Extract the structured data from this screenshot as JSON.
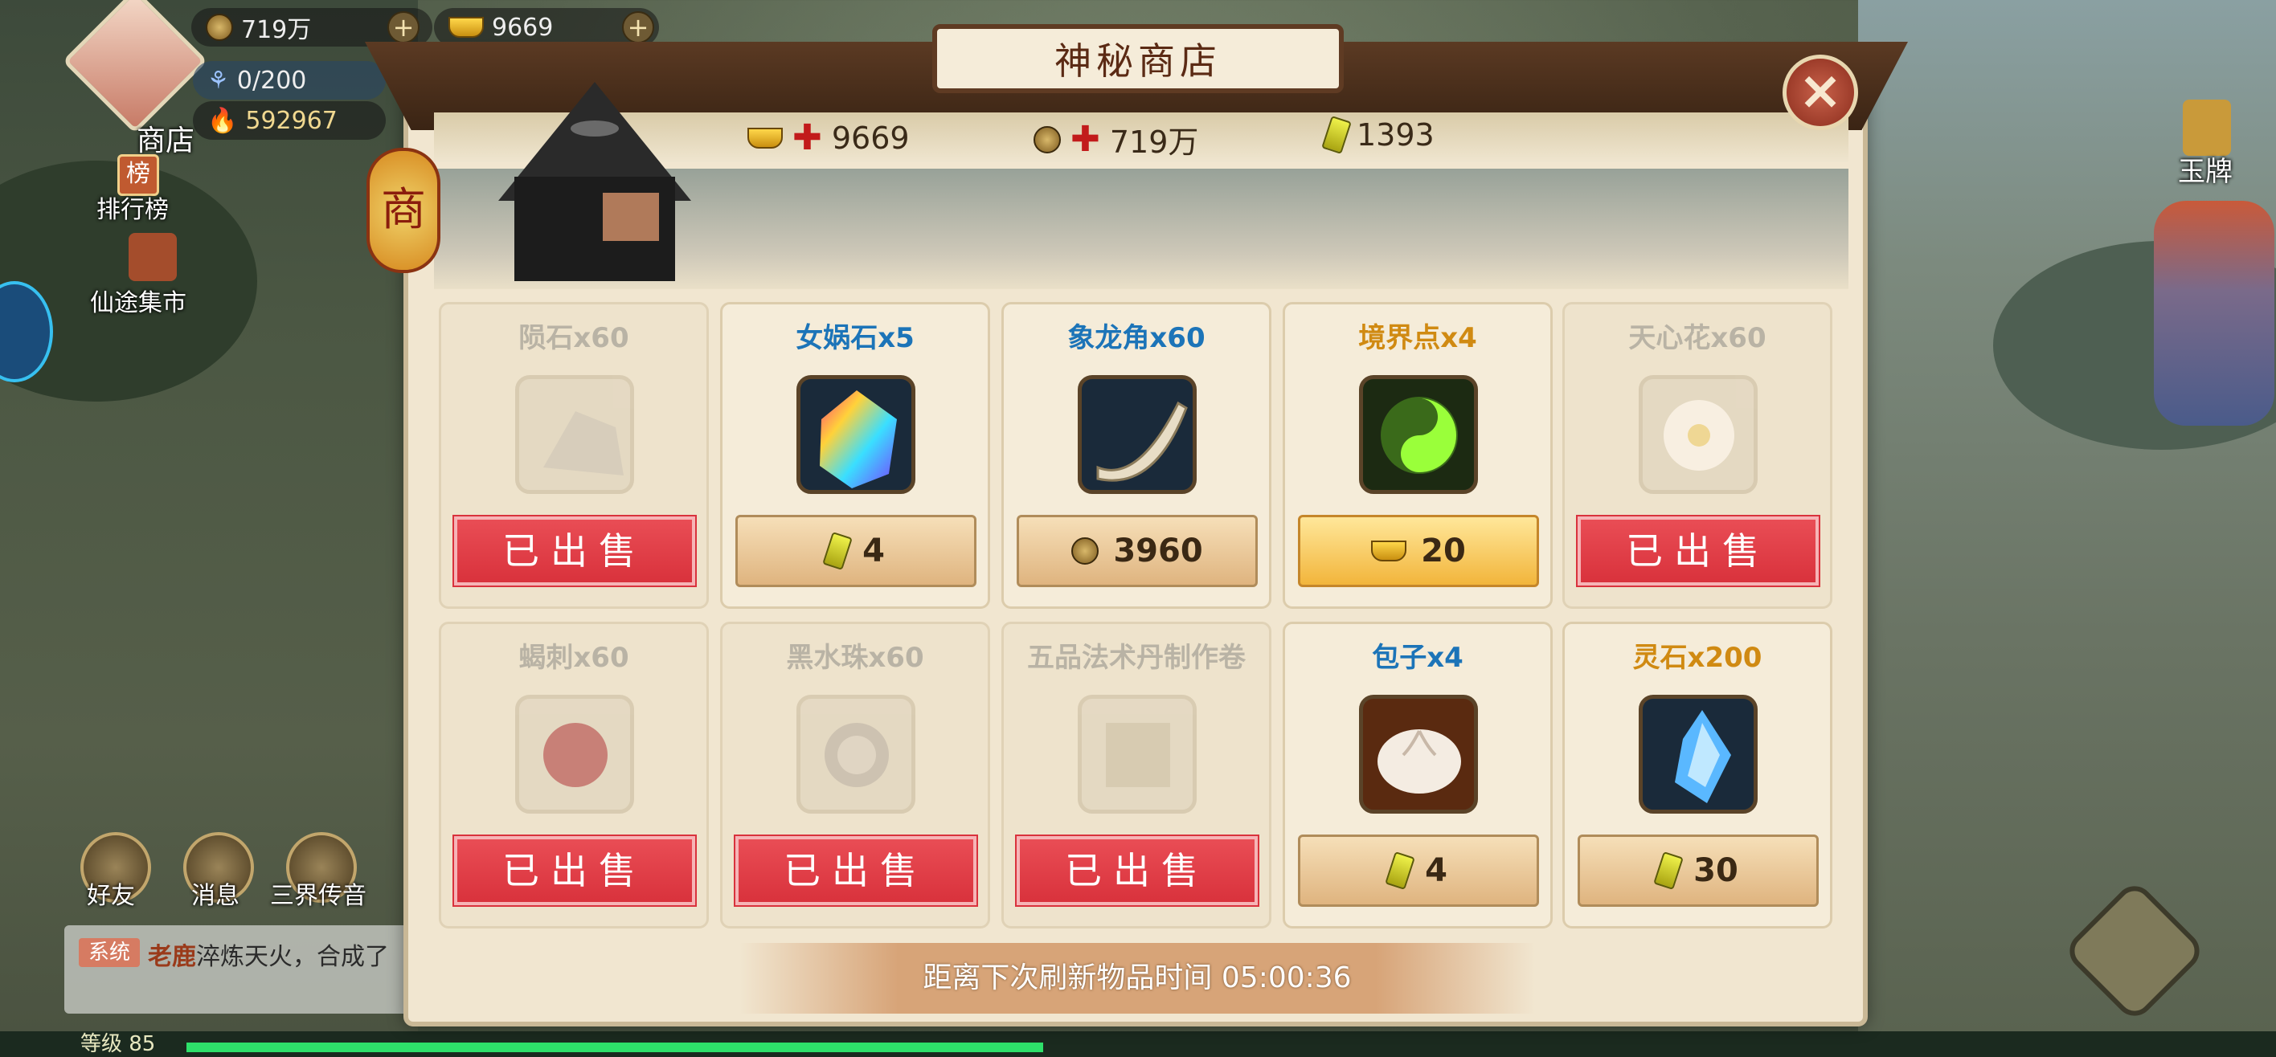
{
  "hud": {
    "coins": "719万",
    "ingots": "9669",
    "stamina": "0/200",
    "power": "592967",
    "shop_label": "商店",
    "rank_label": "排行榜",
    "market_label": "仙途集市",
    "right_label": "玉牌",
    "friends_label": "好友",
    "messages_label": "消息",
    "realm_label": "三界传音",
    "chat_tag": "系统",
    "chat_name": "老鹿",
    "chat_msg": "淬炼天火，合成了",
    "level_text": "等级 85",
    "level_progress": 0.41
  },
  "dialog": {
    "title": "神秘商店",
    "close_icon": "×",
    "lantern_char": "商",
    "currencies": [
      {
        "icon": "gold-ingot-icon",
        "value": "9669",
        "plus": "✚"
      },
      {
        "icon": "coin-icon",
        "value": "719万",
        "plus": "✚"
      },
      {
        "icon": "jade-token-icon",
        "value": "1393"
      }
    ],
    "sold_label": "已出售",
    "items": [
      {
        "name": "陨石x60",
        "icon": "meteorite-icon",
        "sold": true,
        "color": "#b9b3a5"
      },
      {
        "name": "女娲石x5",
        "icon": "nuwa-stone-icon",
        "sold": false,
        "color": "#1c74b8",
        "price_icon": "jade-token-icon",
        "price": "4"
      },
      {
        "name": "象龙角x60",
        "icon": "dragon-horn-icon",
        "sold": false,
        "color": "#1c74b8",
        "price_icon": "coin-icon",
        "price": "3960"
      },
      {
        "name": "境界点x4",
        "icon": "realm-point-icon",
        "sold": false,
        "color": "#d08a12",
        "price_icon": "gold-ingot-icon",
        "price": "20"
      },
      {
        "name": "天心花x60",
        "icon": "flower-icon",
        "sold": true,
        "color": "#b9b3a5"
      },
      {
        "name": "蝎刺x60",
        "icon": "scorpion-sting-icon",
        "sold": true,
        "color": "#b9b3a5"
      },
      {
        "name": "黑水珠x60",
        "icon": "black-pearl-icon",
        "sold": true,
        "color": "#b9b3a5"
      },
      {
        "name": "五品法术丹制作卷",
        "icon": "scroll-icon",
        "sold": true,
        "color": "#b9b3a5"
      },
      {
        "name": "包子x4",
        "icon": "bun-icon",
        "sold": false,
        "color": "#1c74b8",
        "price_icon": "jade-token-icon",
        "price": "4"
      },
      {
        "name": "灵石x200",
        "icon": "spirit-stone-icon",
        "sold": false,
        "color": "#d08a12",
        "price_icon": "jade-token-icon",
        "price": "30"
      }
    ],
    "refresh_label": "距离下次刷新物品时间",
    "refresh_time": "05:00:36"
  }
}
